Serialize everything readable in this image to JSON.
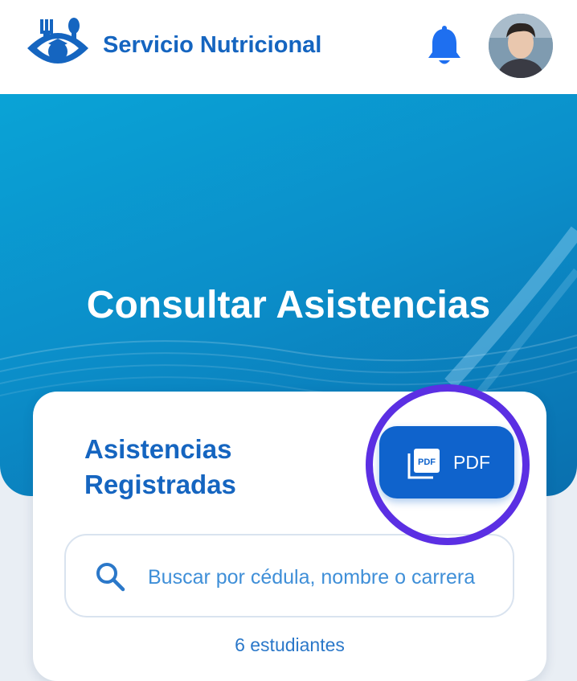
{
  "app": {
    "title": "Servicio Nutricional",
    "logo_icon": "school-dining-logo-icon",
    "notification_icon": "bell-icon",
    "avatar_icon": "user-avatar"
  },
  "hero": {
    "title": "Consultar Asistencias"
  },
  "card": {
    "title": "Asistencias Registradas",
    "pdf_button": {
      "icon": "pdf-file-icon",
      "icon_text": "PDF",
      "label": "PDF"
    },
    "search": {
      "icon": "search-icon",
      "placeholder": "Buscar por cédula, nombre o carrera",
      "value": ""
    },
    "count_label": "6 estudiantes"
  },
  "colors": {
    "brand": "#1565c0",
    "hero_gradient_start": "#0aa3d6",
    "hero_gradient_end": "#0a6fae",
    "pdf_button": "#0f63cc",
    "highlight_ring": "#5b2fe3",
    "page_background": "#e9eef4"
  }
}
